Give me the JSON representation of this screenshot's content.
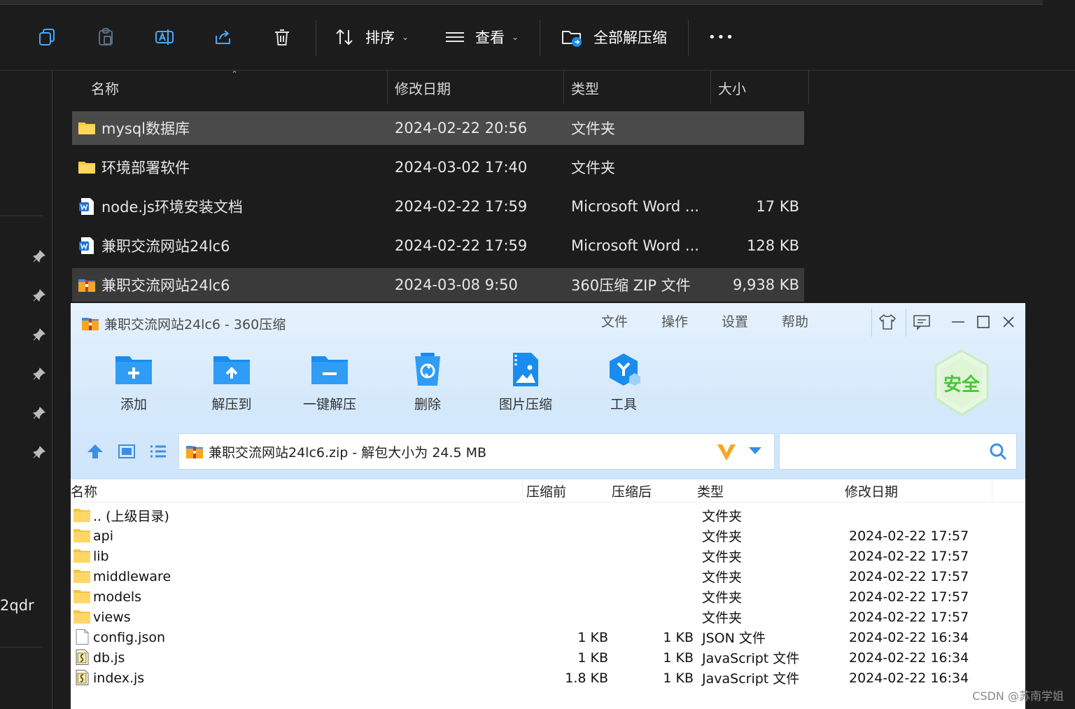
{
  "explorer": {
    "toolbar": {
      "sort_label": "排序",
      "view_label": "查看",
      "extract_all_label": "全部解压缩",
      "more_label": "•••"
    },
    "columns": {
      "name": "名称",
      "modified": "修改日期",
      "type": "类型",
      "size": "大小"
    },
    "rows": [
      {
        "name": "mysql数据库",
        "modified": "2024-02-22 20:56",
        "type": "文件夹",
        "size": "",
        "icon": "folder-icon"
      },
      {
        "name": "环境部署软件",
        "modified": "2024-03-02 17:40",
        "type": "文件夹",
        "size": "",
        "icon": "folder-icon"
      },
      {
        "name": "node.js环境安装文档",
        "modified": "2024-02-22 17:59",
        "type": "Microsoft Word ...",
        "size": "17 KB",
        "icon": "word-doc-icon"
      },
      {
        "name": "兼职交流网站24lc6",
        "modified": "2024-02-22 17:59",
        "type": "Microsoft Word ...",
        "size": "128 KB",
        "icon": "word-doc-icon"
      },
      {
        "name": "兼职交流网站24lc6",
        "modified": "2024-03-08 9:50",
        "type": "360压缩 ZIP 文件",
        "size": "9,938 KB",
        "icon": "zip-archive-icon"
      }
    ],
    "sidebar_partial_text": "2qdr"
  },
  "zip": {
    "title": "兼职交流网站24lc6 - 360压缩",
    "menu": [
      "文件",
      "操作",
      "设置",
      "帮助"
    ],
    "tools": [
      "添加",
      "解压到",
      "一键解压",
      "删除",
      "图片压缩",
      "工具"
    ],
    "security_badge": "安全",
    "address": "兼职交流网站24lc6.zip - 解包大小为 24.5 MB",
    "columns": {
      "name": "名称",
      "before": "压缩前",
      "after": "压缩后",
      "type": "类型",
      "modified": "修改日期"
    },
    "rows": [
      {
        "name": ".. (上级目录)",
        "before": "",
        "after": "",
        "type": "文件夹",
        "modified": "",
        "icon": "folder-icon"
      },
      {
        "name": "api",
        "before": "",
        "after": "",
        "type": "文件夹",
        "modified": "2024-02-22 17:57",
        "icon": "folder-icon"
      },
      {
        "name": "lib",
        "before": "",
        "after": "",
        "type": "文件夹",
        "modified": "2024-02-22 17:57",
        "icon": "folder-icon"
      },
      {
        "name": "middleware",
        "before": "",
        "after": "",
        "type": "文件夹",
        "modified": "2024-02-22 17:57",
        "icon": "folder-icon"
      },
      {
        "name": "models",
        "before": "",
        "after": "",
        "type": "文件夹",
        "modified": "2024-02-22 17:57",
        "icon": "folder-icon"
      },
      {
        "name": "views",
        "before": "",
        "after": "",
        "type": "文件夹",
        "modified": "2024-02-22 17:57",
        "icon": "folder-icon"
      },
      {
        "name": "config.json",
        "before": "1 KB",
        "after": "1 KB",
        "type": "JSON 文件",
        "modified": "2024-02-22 16:34",
        "icon": "json-file-icon"
      },
      {
        "name": "db.js",
        "before": "1 KB",
        "after": "1 KB",
        "type": "JavaScript 文件",
        "modified": "2024-02-22 16:34",
        "icon": "js-file-icon"
      },
      {
        "name": "index.js",
        "before": "1.8 KB",
        "after": "1 KB",
        "type": "JavaScript 文件",
        "modified": "2024-02-22 16:34",
        "icon": "js-file-icon"
      }
    ]
  },
  "watermark": "CSDN @苏南学姐",
  "colors": {
    "explorer_bg": "#1c1c1c",
    "selected_row": "#4a4a4a",
    "accent_blue": "#1a8cf0",
    "zip_header": "#d5e9fb"
  }
}
